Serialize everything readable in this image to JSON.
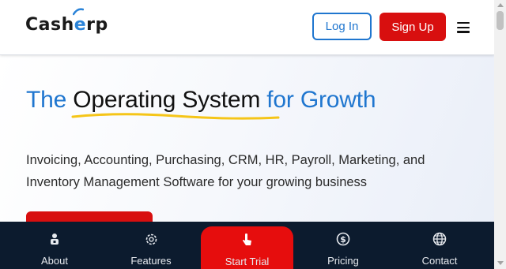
{
  "header": {
    "logo": {
      "part1": "Cash",
      "part2": "e",
      "part3": "rp"
    },
    "login_label": "Log In",
    "signup_label": "Sign Up"
  },
  "hero": {
    "headline_prefix": "The ",
    "headline_highlight": "Operating System",
    "headline_suffix": " for Growth",
    "subtitle": "Invoicing, Accounting, Purchasing, CRM, HR, Payroll, Marketing, and Inventory Management Software for your growing business"
  },
  "bottom_nav": {
    "items": [
      {
        "label": "About",
        "icon": "person-icon"
      },
      {
        "label": "Features",
        "icon": "gear-icon"
      },
      {
        "label": "Start Trial",
        "icon": "hand-pointer-icon",
        "active": true
      },
      {
        "label": "Pricing",
        "icon": "dollar-icon"
      },
      {
        "label": "Contact",
        "icon": "globe-icon"
      }
    ]
  },
  "colors": {
    "brand_blue": "#1f76cf",
    "brand_red": "#d80f0f",
    "nav_bg": "#0c1b2e",
    "underline_yellow": "#f5c518"
  }
}
